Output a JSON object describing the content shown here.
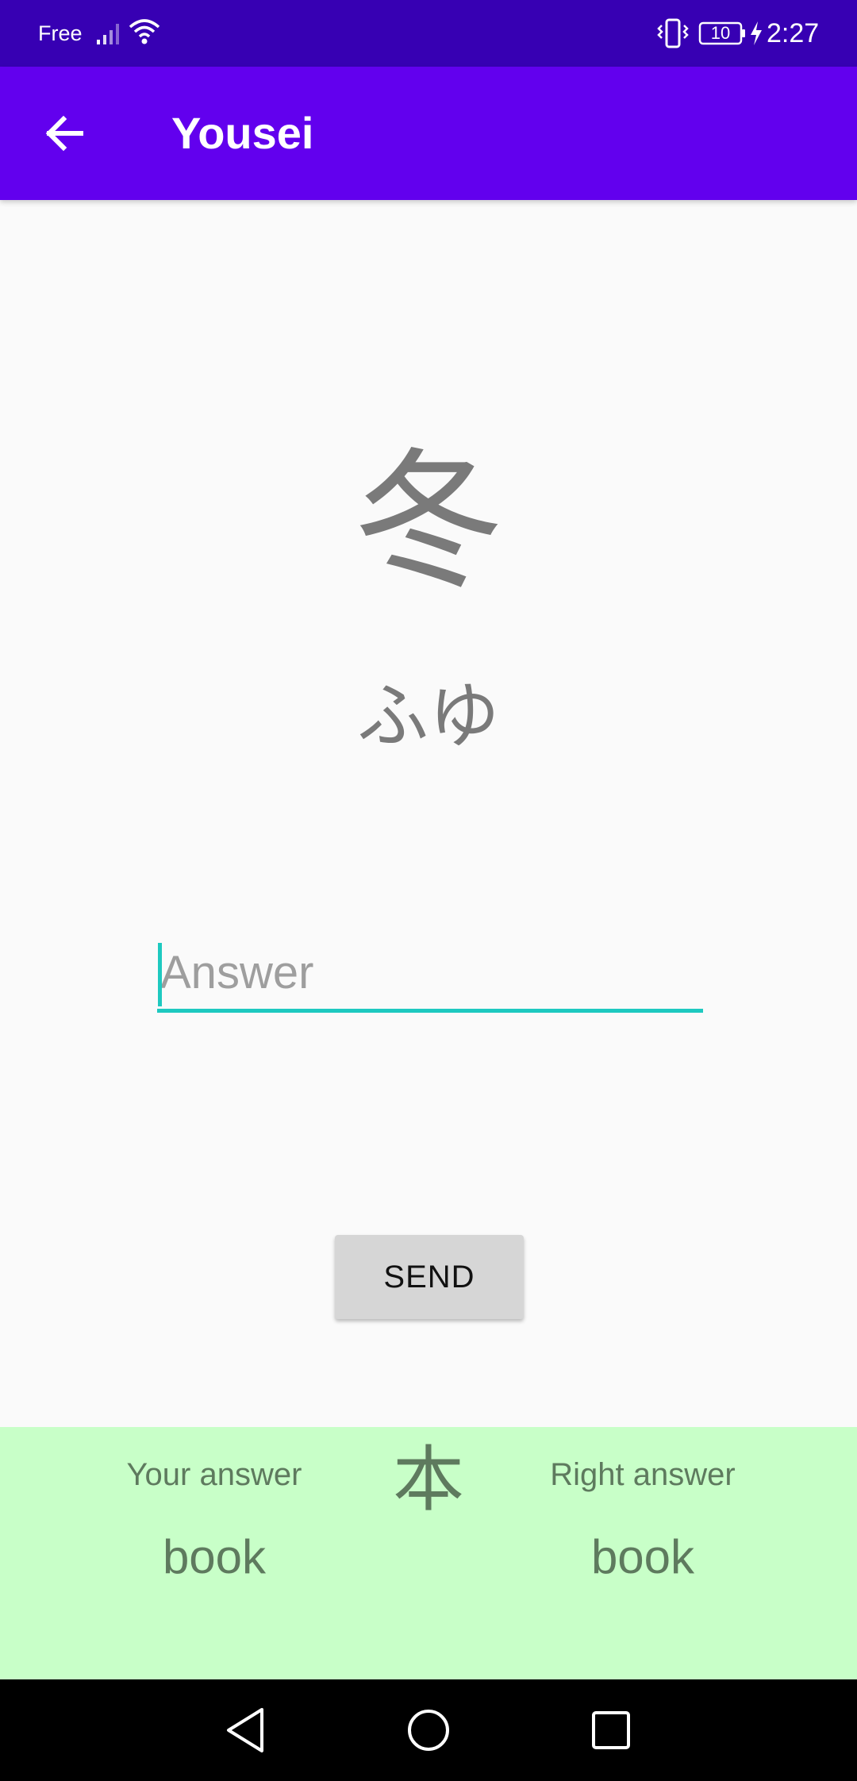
{
  "status_bar": {
    "carrier": "Free",
    "battery_level": "10",
    "time": "2:27",
    "icons": [
      "signal-icon",
      "wifi-icon",
      "vibrate-icon",
      "battery-icon",
      "charging-bolt-icon"
    ]
  },
  "app_bar": {
    "title": "Yousei",
    "back_icon": "arrow-left-icon"
  },
  "quiz": {
    "kanji": "冬",
    "reading": "ふゆ"
  },
  "answer_input": {
    "placeholder": "Answer",
    "value": ""
  },
  "send_button": {
    "label": "SEND"
  },
  "result": {
    "your_answer_label": "Your answer",
    "your_answer_value": "book",
    "kanji": "本",
    "right_answer_label": "Right answer",
    "right_answer_value": "book",
    "background_color": "#c8ffc8"
  },
  "nav_bar": {
    "icons": [
      "nav-back-icon",
      "nav-home-icon",
      "nav-recent-icon"
    ]
  },
  "colors": {
    "status_bar": "#3700b3",
    "app_bar": "#6200ee",
    "accent": "#1ec9c0",
    "button": "#d6d6d6"
  }
}
